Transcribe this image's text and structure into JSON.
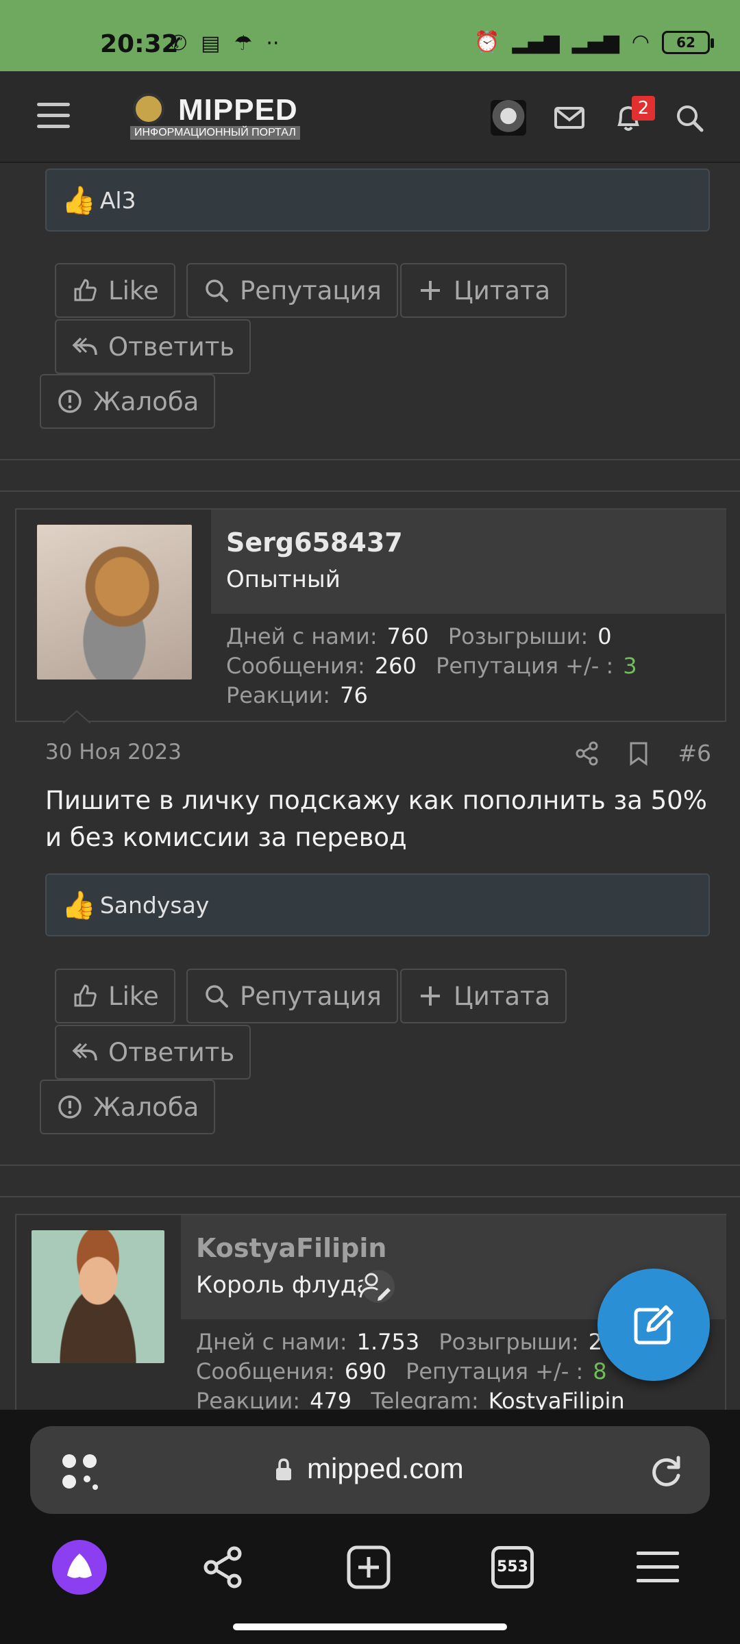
{
  "status_bar": {
    "time": "20:32",
    "battery": "62"
  },
  "header": {
    "logo_title": "MIPPED",
    "logo_subtitle": "ИНФОРМАЦИОННЫЙ ПОРТАЛ",
    "notifications_count": "2"
  },
  "post5": {
    "reaction_user": "Al3",
    "actions": {
      "like": "Like",
      "reputation": "Репутация",
      "quote": "Цитата",
      "reply": "Ответить",
      "report": "Жалоба"
    }
  },
  "post6": {
    "username": "Serg658437",
    "user_title": "Опытный",
    "stats": {
      "days_label": "Дней с нами:",
      "days": "760",
      "giveaways_label": "Розыгрыши:",
      "giveaways": "0",
      "messages_label": "Сообщения:",
      "messages": "260",
      "reputation_label": "Репутация +/- :",
      "reputation": "3",
      "reactions_label": "Реакции:",
      "reactions": "76"
    },
    "date": "30 Ноя 2023",
    "number": "#6",
    "text": "Пишите в личку подскажу как пополнить за 50% и без комиссии за перевод",
    "reaction_user": "Sandysay",
    "actions": {
      "like": "Like",
      "reputation": "Репутация",
      "quote": "Цитата",
      "reply": "Ответить",
      "report": "Жалоба"
    }
  },
  "post7": {
    "username": "KostyaFilipin",
    "user_title": "Король флуда",
    "stats": {
      "days_label": "Дней с нами:",
      "days": "1.753",
      "giveaways_label": "Розыгрыши:",
      "giveaways": "2",
      "messages_label": "Сообщения:",
      "messages": "690",
      "reputation_label": "Репутация +/- :",
      "reputation": "8",
      "reactions_label": "Реакции:",
      "reactions": "479",
      "telegram_label": "Telegram:",
      "telegram": "KostyaFilipin"
    }
  },
  "browser": {
    "url": "mipped.com",
    "tabs_count": "553"
  },
  "colors": {
    "status_bar": "#6fa85f",
    "accent_fab": "#2b8fd6",
    "reputation_green": "#6fbf5a",
    "badge_red": "#e23030"
  }
}
